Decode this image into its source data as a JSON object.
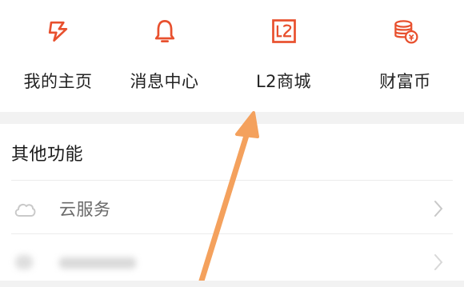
{
  "quick_actions": [
    {
      "label": "我的主页",
      "icon": "lightning-icon"
    },
    {
      "label": "消息中心",
      "icon": "bell-icon"
    },
    {
      "label": "L2商城",
      "icon": "l2-store-icon"
    },
    {
      "label": "财富币",
      "icon": "coins-icon"
    }
  ],
  "other_functions": {
    "title": "其他功能",
    "items": [
      {
        "label": "云服务",
        "icon": "cloud-icon"
      },
      {
        "label": "",
        "icon": "blurred-icon"
      }
    ]
  },
  "colors": {
    "accent": "#e8502e",
    "annotation_arrow": "#f4a15d",
    "chevron": "#c8c8c8",
    "cloud": "#c9c9c9"
  }
}
